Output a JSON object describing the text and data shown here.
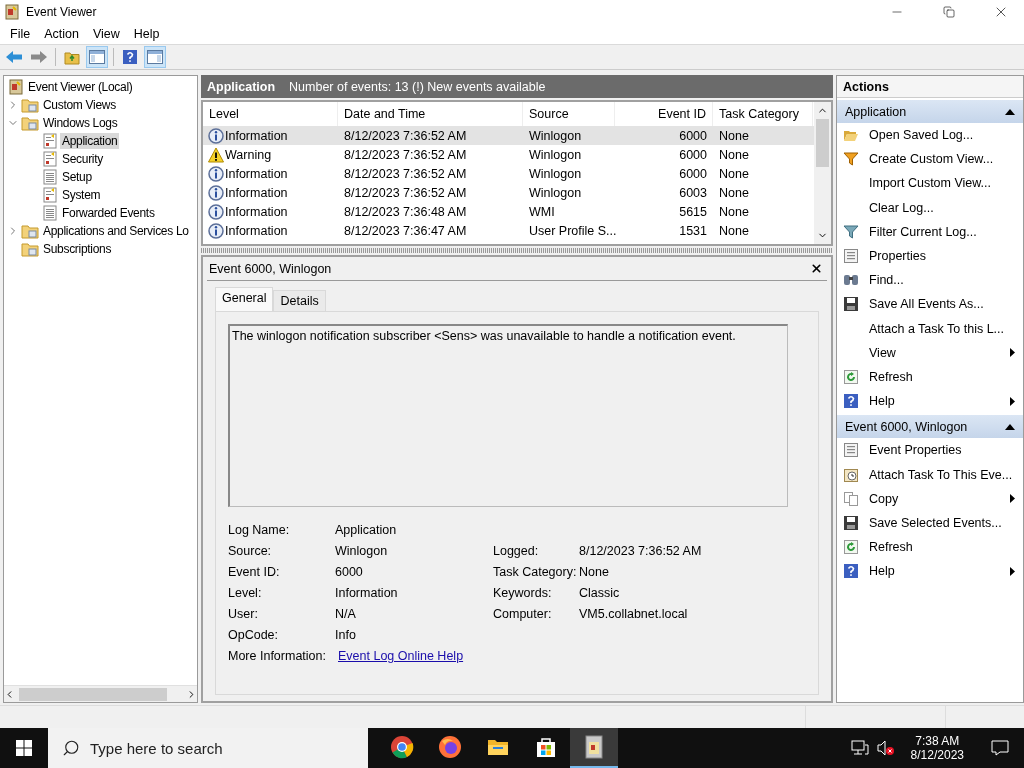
{
  "window": {
    "title": "Event Viewer"
  },
  "menu": [
    "File",
    "Action",
    "View",
    "Help"
  ],
  "toolbar": [
    {
      "pressed": false
    },
    {
      "pressed": false
    },
    {
      "pressed": false
    },
    {
      "pressed": true
    },
    {
      "pressed": false
    },
    {
      "pressed": true
    }
  ],
  "tree": [
    {
      "label": "Event Viewer (Local)",
      "kind": "root",
      "selected": false,
      "children": [
        {
          "label": "Custom Views",
          "kind": "folder",
          "expanded": false,
          "selected": false
        },
        {
          "label": "Windows Logs",
          "kind": "folder",
          "expanded": true,
          "selected": false,
          "children": [
            {
              "label": "Application",
              "kind": "log",
              "selected": true
            },
            {
              "label": "Security",
              "kind": "log",
              "selected": false
            },
            {
              "label": "Setup",
              "kind": "plain-log",
              "selected": false
            },
            {
              "label": "System",
              "kind": "log",
              "selected": false
            },
            {
              "label": "Forwarded Events",
              "kind": "plain-log",
              "selected": false
            }
          ]
        },
        {
          "label": "Applications and Services Lo",
          "kind": "folder",
          "expanded": false,
          "selected": false
        },
        {
          "label": "Subscriptions",
          "kind": "folder",
          "selected": false
        }
      ]
    }
  ],
  "log_header": {
    "name": "Application",
    "summary": "Number of events: 13 (!) New events available"
  },
  "table": {
    "columns": [
      "Level",
      "Date and Time",
      "Source",
      "Event ID",
      "Task Category"
    ],
    "rows": [
      {
        "kind": "information",
        "level": "Information",
        "date": "8/12/2023 7:36:52 AM",
        "source": "Winlogon",
        "event_id": "6000",
        "category": "None",
        "selected": true
      },
      {
        "kind": "warning",
        "level": "Warning",
        "date": "8/12/2023 7:36:52 AM",
        "source": "Winlogon",
        "event_id": "6000",
        "category": "None",
        "selected": false
      },
      {
        "kind": "information",
        "level": "Information",
        "date": "8/12/2023 7:36:52 AM",
        "source": "Winlogon",
        "event_id": "6000",
        "category": "None",
        "selected": false
      },
      {
        "kind": "information",
        "level": "Information",
        "date": "8/12/2023 7:36:52 AM",
        "source": "Winlogon",
        "event_id": "6003",
        "category": "None",
        "selected": false
      },
      {
        "kind": "information",
        "level": "Information",
        "date": "8/12/2023 7:36:48 AM",
        "source": "WMI",
        "event_id": "5615",
        "category": "None",
        "selected": false
      },
      {
        "kind": "information",
        "level": "Information",
        "date": "8/12/2023 7:36:47 AM",
        "source": "User Profile S...",
        "event_id": "1531",
        "category": "None",
        "selected": false
      }
    ]
  },
  "event_panel": {
    "title": "Event 6000, Winlogon",
    "tabs": [
      {
        "label": "General",
        "selected": true
      },
      {
        "label": "Details",
        "selected": false
      }
    ],
    "message": "The winlogon notification subscriber <Sens> was unavailable to handle a notification event.",
    "rows": [
      {
        "left": {
          "label": "Log Name:",
          "value": "Application"
        }
      },
      {
        "left": {
          "label": "Source:",
          "value": "Winlogon"
        },
        "right": {
          "label": "Logged:",
          "value": "8/12/2023 7:36:52 AM"
        }
      },
      {
        "left": {
          "label": "Event ID:",
          "value": "6000"
        },
        "right": {
          "label": "Task Category:",
          "value": "None"
        }
      },
      {
        "left": {
          "label": "Level:",
          "value": "Information"
        },
        "right": {
          "label": "Keywords:",
          "value": "Classic"
        }
      },
      {
        "left": {
          "label": "User:",
          "value": "N/A"
        },
        "right": {
          "label": "Computer:",
          "value": "VM5.collabnet.local"
        }
      },
      {
        "left": {
          "label": "OpCode:",
          "value": "Info"
        }
      }
    ],
    "more_info": {
      "label": "More Information:",
      "link": "Event Log Online Help"
    }
  },
  "actions": {
    "title": "Actions",
    "sections": [
      {
        "title": "Application",
        "expanded": true,
        "items": [
          {
            "label": "Open Saved Log...",
            "kind": "open",
            "submenu": false
          },
          {
            "label": "Create Custom View...",
            "kind": "funnel",
            "submenu": false
          },
          {
            "label": "Import Custom View...",
            "kind": "blank",
            "submenu": false
          },
          {
            "label": "Clear Log...",
            "kind": "blank",
            "submenu": false
          },
          {
            "label": "Filter Current Log...",
            "kind": "filter",
            "submenu": false
          },
          {
            "label": "Properties",
            "kind": "properties",
            "submenu": false
          },
          {
            "label": "Find...",
            "kind": "find",
            "submenu": false
          },
          {
            "label": "Save All Events As...",
            "kind": "save",
            "submenu": false
          },
          {
            "label": "Attach a Task To this L...",
            "kind": "blank",
            "submenu": false
          },
          {
            "label": "View",
            "kind": "blank",
            "submenu": true
          },
          {
            "label": "Refresh",
            "kind": "refresh",
            "submenu": false
          },
          {
            "label": "Help",
            "kind": "help",
            "submenu": true
          }
        ]
      },
      {
        "title": "Event 6000, Winlogon",
        "expanded": true,
        "items": [
          {
            "label": "Event Properties",
            "kind": "properties",
            "submenu": false
          },
          {
            "label": "Attach Task To This Eve...",
            "kind": "clock",
            "submenu": false
          },
          {
            "label": "Copy",
            "kind": "copy",
            "submenu": true
          },
          {
            "label": "Save Selected Events...",
            "kind": "save",
            "submenu": false
          },
          {
            "label": "Refresh",
            "kind": "refresh",
            "submenu": false
          },
          {
            "label": "Help",
            "kind": "help",
            "submenu": true
          }
        ]
      }
    ]
  },
  "taskbar": {
    "search_placeholder": "Type here to search",
    "apps": [
      {
        "selected": false
      },
      {
        "selected": false
      },
      {
        "selected": false
      },
      {
        "selected": false
      },
      {
        "selected": true
      }
    ],
    "time": "7:38 AM",
    "date": "8/12/2023"
  }
}
